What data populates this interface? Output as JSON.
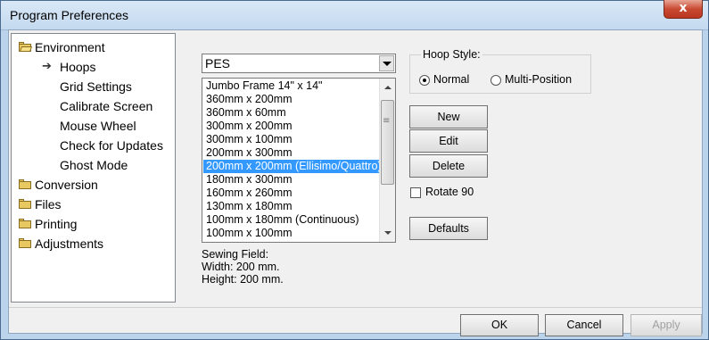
{
  "window": {
    "title": "Program Preferences",
    "close_glyph": "x"
  },
  "tree": {
    "items": [
      {
        "label": "Environment",
        "icon": "folder-open-icon"
      },
      {
        "label": "Hoops",
        "icon": "arrow-right-icon"
      },
      {
        "label": "Grid Settings"
      },
      {
        "label": "Calibrate Screen"
      },
      {
        "label": "Mouse Wheel"
      },
      {
        "label": "Check for Updates"
      },
      {
        "label": "Ghost Mode"
      },
      {
        "label": "Conversion",
        "icon": "folder-icon"
      },
      {
        "label": "Files",
        "icon": "folder-icon"
      },
      {
        "label": "Printing",
        "icon": "folder-icon"
      },
      {
        "label": "Adjustments",
        "icon": "folder-icon"
      }
    ],
    "arrow_glyph": "➔"
  },
  "format": {
    "selected": "PES"
  },
  "hoops": {
    "items": [
      "Jumbo Frame 14\" x 14\"",
      "360mm x 200mm",
      "360mm x 60mm",
      "300mm x 200mm",
      "300mm x 100mm",
      "200mm x 300mm",
      "200mm x 200mm (Ellisimo/Quattro)",
      "180mm x 300mm",
      "160mm x 260mm",
      "130mm x 180mm",
      "100mm x 180mm (Continuous)",
      "100mm x 100mm"
    ],
    "selected_index": 6
  },
  "sewing_field": {
    "title": "Sewing Field:",
    "width": "Width: 200 mm.",
    "height": "Height: 200 mm."
  },
  "hoop_style": {
    "label": "Hoop Style:",
    "normal": "Normal",
    "multi": "Multi-Position",
    "selected": "Normal"
  },
  "buttons": {
    "new": "New",
    "edit": "Edit",
    "delete": "Delete",
    "defaults": "Defaults",
    "ok": "OK",
    "cancel": "Cancel",
    "apply": "Apply"
  },
  "rotate": {
    "label": "Rotate 90",
    "checked": false
  }
}
